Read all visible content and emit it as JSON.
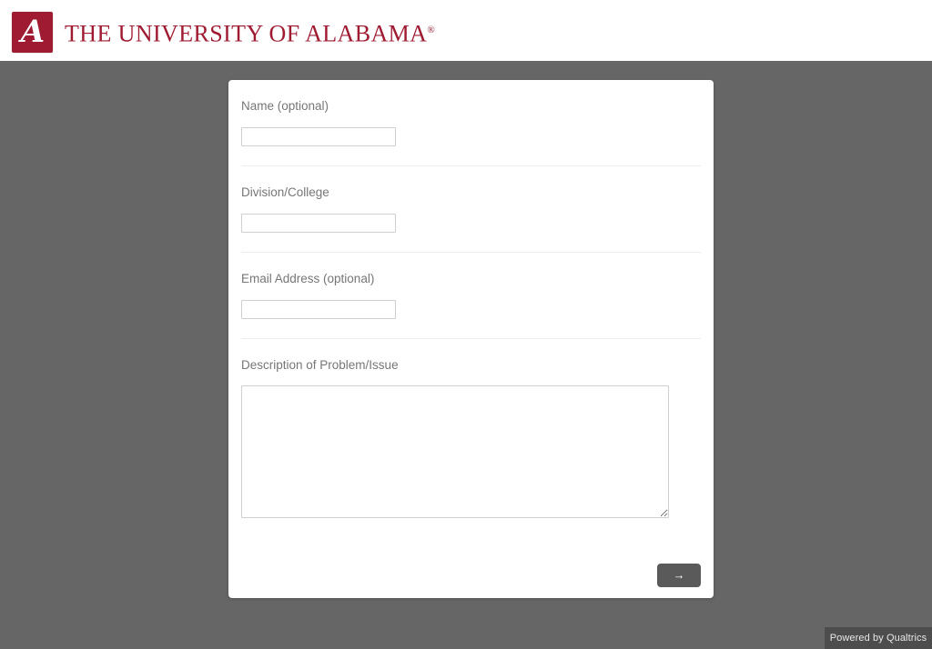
{
  "header": {
    "logo_icon": "alabama-script-a-logo",
    "logo_glyph": "A",
    "brand_name": "THE UNIVERSITY OF ALABAMA",
    "registered_mark": "®",
    "brand_color": "#9E1B32",
    "background_color": "#ffffff"
  },
  "page": {
    "background_color": "#666666",
    "card_background_color": "#ffffff"
  },
  "form": {
    "questions": [
      {
        "label": "Name (optional)",
        "type": "text",
        "value": "",
        "placeholder": ""
      },
      {
        "label": "Division/College",
        "type": "text",
        "value": "",
        "placeholder": ""
      },
      {
        "label": "Email Address (optional)",
        "type": "text",
        "value": "",
        "placeholder": ""
      },
      {
        "label": "Description of Problem/Issue",
        "type": "textarea",
        "value": "",
        "placeholder": ""
      }
    ],
    "next_button": {
      "icon": "arrow-right-icon",
      "label": "→",
      "color": "#5a5a5a"
    }
  },
  "footer": {
    "powered_by": "Powered by Qualtrics",
    "background_color": "#4d4d4d"
  }
}
